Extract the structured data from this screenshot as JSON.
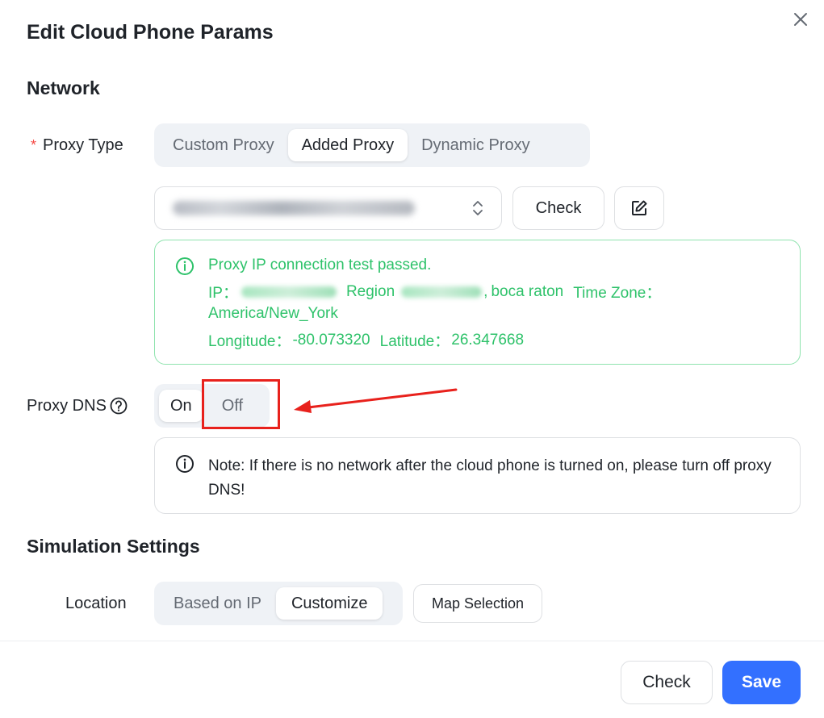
{
  "dialog": {
    "title": "Edit Cloud Phone Params"
  },
  "network": {
    "section_title": "Network",
    "proxy_type": {
      "required_mark": "*",
      "label": "Proxy Type",
      "options": [
        "Custom Proxy",
        "Added Proxy",
        "Dynamic Proxy"
      ],
      "selected": "Added Proxy"
    },
    "proxy_select": {
      "value_obscured": true
    },
    "check_label": "Check",
    "test_result": {
      "line1": "Proxy IP connection test passed.",
      "ip_label": "IP：",
      "region_label": "Region",
      "region_sep": ",",
      "region_city": "boca raton",
      "timezone_label": "Time Zone：",
      "timezone_value": "America/New_York",
      "longitude_label": "Longitude：",
      "longitude_value": "-80.073320",
      "latitude_label": "Latitude：",
      "latitude_value": "26.347668"
    },
    "proxy_dns": {
      "label": "Proxy DNS",
      "options": [
        "On",
        "Off"
      ],
      "selected": "On"
    },
    "note": "Note: If there is no network after the cloud phone is turned on, please turn off proxy DNS!"
  },
  "simulation": {
    "section_title": "Simulation Settings",
    "location": {
      "label": "Location",
      "options": [
        "Based on IP",
        "Customize"
      ],
      "selected": "Customize"
    },
    "map_selection_label": "Map Selection"
  },
  "footer": {
    "check_label": "Check",
    "save_label": "Save"
  },
  "colors": {
    "primary": "#3370ff",
    "success": "#2ec26a",
    "annotation": "#e8211c"
  }
}
